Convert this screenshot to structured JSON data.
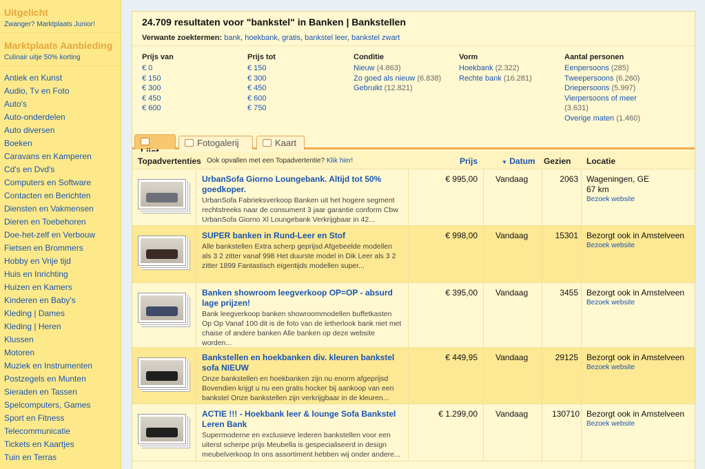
{
  "sidebar": {
    "promo1": {
      "title": "Uitgelicht",
      "sub": "Zwanger? Marktplaats Junior!"
    },
    "promo2": {
      "title": "Marktplaats Aanbieding",
      "sub": "Culinair uitje 50% korting"
    },
    "categories": [
      "Antiek en Kunst",
      "Audio, Tv en Foto",
      "Auto's",
      "Auto-onderdelen",
      "Auto diversen",
      "Boeken",
      "Caravans en Kamperen",
      "Cd's en Dvd's",
      "Computers en Software",
      "Contacten en Berichten",
      "Diensten en Vakmensen",
      "Dieren en Toebehoren",
      "Doe-het-zelf en Verbouw",
      "Fietsen en Brommers",
      "Hobby en Vrije tijd",
      "Huis en Inrichting",
      "Huizen en Kamers",
      "Kinderen en Baby's",
      "Kleding | Dames",
      "Kleding | Heren",
      "Klussen",
      "Motoren",
      "Muziek en Instrumenten",
      "Postzegels en Munten",
      "Sieraden en Tassen",
      "Spelcomputers, Games",
      "Sport en Fitness",
      "Telecommunicatie",
      "Tickets en Kaartjes",
      "Tuin en Terras"
    ]
  },
  "header": {
    "title": "24.709 resultaten voor \"bankstel\" in Banken | Bankstellen",
    "related_label": "Verwante zoektermen:",
    "related": [
      "bank",
      "hoekbank",
      "gratis",
      "bankstel leer",
      "bankstel zwart"
    ]
  },
  "filters": {
    "prijs_van": {
      "label": "Prijs van",
      "items": [
        {
          "text": "€ 0",
          "count": ""
        },
        {
          "text": "€ 150",
          "count": ""
        },
        {
          "text": "€ 300",
          "count": ""
        },
        {
          "text": "€ 450",
          "count": ""
        },
        {
          "text": "€ 600",
          "count": ""
        }
      ]
    },
    "prijs_tot": {
      "label": "Prijs tot",
      "items": [
        {
          "text": "€ 150",
          "count": ""
        },
        {
          "text": "€ 300",
          "count": ""
        },
        {
          "text": "€ 450",
          "count": ""
        },
        {
          "text": "€ 600",
          "count": ""
        },
        {
          "text": "€ 750",
          "count": ""
        }
      ]
    },
    "conditie": {
      "label": "Conditie",
      "items": [
        {
          "text": "Nieuw",
          "count": "(4.863)"
        },
        {
          "text": "Zo goed als nieuw",
          "count": "(6.838)"
        },
        {
          "text": "Gebruikt",
          "count": "(12.821)"
        }
      ]
    },
    "vorm": {
      "label": "Vorm",
      "items": [
        {
          "text": "Hoekbank",
          "count": "(2.322)"
        },
        {
          "text": "Rechte bank",
          "count": "(16.281)"
        }
      ]
    },
    "personen": {
      "label": "Aantal personen",
      "items": [
        {
          "text": "Eenpersoons",
          "count": "(285)"
        },
        {
          "text": "Tweepersoons",
          "count": "(6.260)"
        },
        {
          "text": "Driepersoons",
          "count": "(5.997)"
        },
        {
          "text": "Vierpersoons of meer",
          "count": ""
        },
        {
          "text": "",
          "count": "(3.631)"
        },
        {
          "text": "Overige maten",
          "count": "(1.460)"
        }
      ]
    }
  },
  "tabs": [
    "Lijst",
    "Fotogalerij",
    "Kaart"
  ],
  "table": {
    "headers": {
      "top": "Topadvertenties",
      "promo": "Ook opvallen met een Topadvertentie?",
      "promo_link": "Klik hier!",
      "price": "Prijs",
      "date": "Datum",
      "views": "Gezien",
      "loc": "Locatie"
    },
    "sort_icon": "▼",
    "rows": [
      {
        "title": "UrbanSofa Giorno Loungebank. Altijd tot 50% goedkoper.",
        "desc": "UrbanSofa Fabrieksverkoop Banken uit het hogere segment rechtstreeks naar de consument 3 jaar garantie conform Cbw UrbanSofa Giorno Xl Loungebank Verkrijgbaar in 42...",
        "price": "€ 995,00",
        "date": "Vandaag",
        "views": "2063",
        "loc": "Wageningen, GE",
        "dist": "67 km",
        "web": "Bezoek website"
      },
      {
        "title": "SUPER banken in Rund-Leer en Stof",
        "desc": "Alle bankstellen Extra scherp geprijsd Afgebeelde modellen als 3 2 zitter vanaf 998 Het duurste model in Dik Leer als 3 2 zitter 1899 Fantastisch eigentijds modellen super...",
        "price": "€ 998,00",
        "date": "Vandaag",
        "views": "15301",
        "loc": "Bezorgt ook in Amstelveen",
        "dist": "",
        "web": "Bezoek website"
      },
      {
        "title": "Banken showroom leegverkoop OP=OP - absurd lage prijzen!",
        "desc": "Bank leegverkoop banken showroommodellen buffetkasten Op Op Vanaf 100 dit is de foto van de letherlook bank niet met chaise of andere banken Alle banken op deze website worden...",
        "price": "€ 395,00",
        "date": "Vandaag",
        "views": "3455",
        "loc": "Bezorgt ook in Amstelveen",
        "dist": "",
        "web": "Bezoek website"
      },
      {
        "title": "Bankstellen en hoekbanken div. kleuren bankstel sofa NIEUW",
        "desc": "Onze bankstellen en hoekbanken zijn nu enorm afgeprijsd Bovendien krijgt u nu een gratis hocker bij aankoop van een bankstel Onze bankstellen zijn verkrijgbaar in de kleuren...",
        "price": "€ 449,95",
        "date": "Vandaag",
        "views": "29125",
        "loc": "Bezorgt ook in Amstelveen",
        "dist": "",
        "web": "Bezoek website"
      },
      {
        "title": "ACTIE !!! - Hoekbank leer & lounge Sofa Bankstel Leren Bank",
        "desc": "Supermoderne en exclusieve lederen bankstellen voor een uiterst scherpe prijs Meubella is gespecialiseerd in design meubelverkoop In ons assortiment hebben wij onder andere...",
        "price": "€ 1.299,00",
        "date": "Vandaag",
        "views": "130710",
        "loc": "Bezorgt ook in Amstelveen",
        "dist": "",
        "web": "Bezoek website"
      }
    ]
  },
  "colors": {
    "link": "#1a55b0",
    "sidebar": "#fde98a",
    "row_alt": "#fde893",
    "tab_border": "#f2a94a"
  },
  "icons": {
    "list_tab": "list-icon",
    "gallery_tab": "camera-icon",
    "map_tab": "map-icon"
  }
}
